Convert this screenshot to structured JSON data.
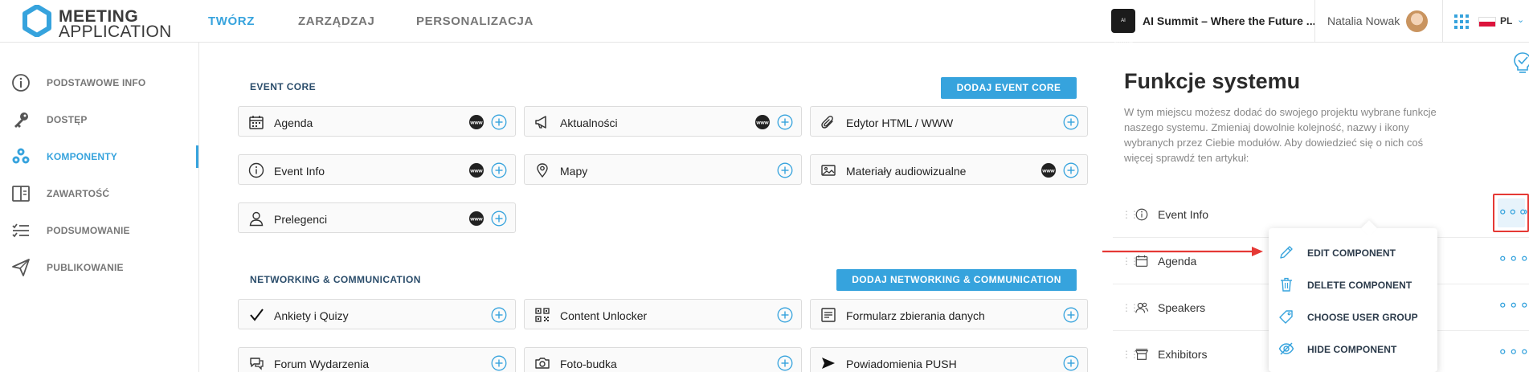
{
  "app": {
    "logo_line1": "MEETING",
    "logo_line2": "APPLICATION"
  },
  "nav": {
    "items": [
      "TWÓRZ",
      "ZARZĄDZAJ",
      "PERSONALIZACJA"
    ],
    "active_index": 0
  },
  "header": {
    "event_badge": "AI SUMMIT",
    "event_name": "AI Summit – Where the Future ...",
    "user_name": "Natalia Nowak",
    "language": "PL"
  },
  "sidebar": {
    "items": [
      {
        "label": "PODSTAWOWE INFO",
        "icon": "info-icon"
      },
      {
        "label": "DOSTĘP",
        "icon": "key-icon"
      },
      {
        "label": "KOMPONENTY",
        "icon": "components-icon",
        "active": true
      },
      {
        "label": "ZAWARTOŚĆ",
        "icon": "content-icon"
      },
      {
        "label": "PODSUMOWANIE",
        "icon": "checklist-icon"
      },
      {
        "label": "PUBLIKOWANIE",
        "icon": "paper-plane-icon"
      }
    ]
  },
  "event_core": {
    "title": "EVENT CORE",
    "add_button": "DODAJ EVENT CORE",
    "items": [
      {
        "label": "Agenda",
        "icon": "calendar-icon",
        "www": true
      },
      {
        "label": "Aktualności",
        "icon": "megaphone-icon",
        "www": true
      },
      {
        "label": "Edytor HTML / WWW",
        "icon": "paperclip-icon",
        "www": false
      },
      {
        "label": "Event Info",
        "icon": "info-icon",
        "www": true
      },
      {
        "label": "Mapy",
        "icon": "map-pin-icon",
        "www": false
      },
      {
        "label": "Materiały audiowizualne",
        "icon": "image-icon",
        "www": true
      },
      {
        "label": "Prelegenci",
        "icon": "person-icon",
        "www": true
      }
    ]
  },
  "networking": {
    "title": "NETWORKING & COMMUNICATION",
    "add_button": "DODAJ NETWORKING & COMMUNICATION",
    "items": [
      {
        "label": "Ankiety i Quizy",
        "icon": "check-icon"
      },
      {
        "label": "Content Unlocker",
        "icon": "qr-code-icon"
      },
      {
        "label": "Formularz zbierania danych",
        "icon": "form-icon"
      },
      {
        "label": "Forum Wydarzenia",
        "icon": "chat-icon"
      },
      {
        "label": "Foto-budka",
        "icon": "camera-icon"
      },
      {
        "label": "Powiadomienia PUSH",
        "icon": "send-icon"
      }
    ]
  },
  "panel": {
    "title": "Funkcje systemu",
    "description": "W tym miejscu możesz dodać do swojego projektu wybrane funkcje naszego systemu. Zmieniaj dowolnie kolejność, nazwy i ikony wybranych przez Ciebie modułów. Aby dowiedzieć się o nich coś więcej sprawdź ten artykuł:",
    "modules": [
      {
        "label": "Event Info",
        "icon": "info-icon"
      },
      {
        "label": "Agenda",
        "icon": "calendar-icon"
      },
      {
        "label": "Speakers",
        "icon": "people-icon"
      },
      {
        "label": "Exhibitors",
        "icon": "booth-icon"
      }
    ]
  },
  "context_menu": {
    "items": [
      {
        "label": "EDIT COMPONENT",
        "icon": "pencil-icon"
      },
      {
        "label": "DELETE COMPONENT",
        "icon": "trash-icon"
      },
      {
        "label": "CHOOSE USER GROUP",
        "icon": "tag-icon"
      },
      {
        "label": "HIDE COMPONENT",
        "icon": "eye-off-icon"
      }
    ]
  },
  "colors": {
    "accent": "#36a3dd",
    "highlight": "#e53935",
    "section_title": "#2b4d6b"
  }
}
